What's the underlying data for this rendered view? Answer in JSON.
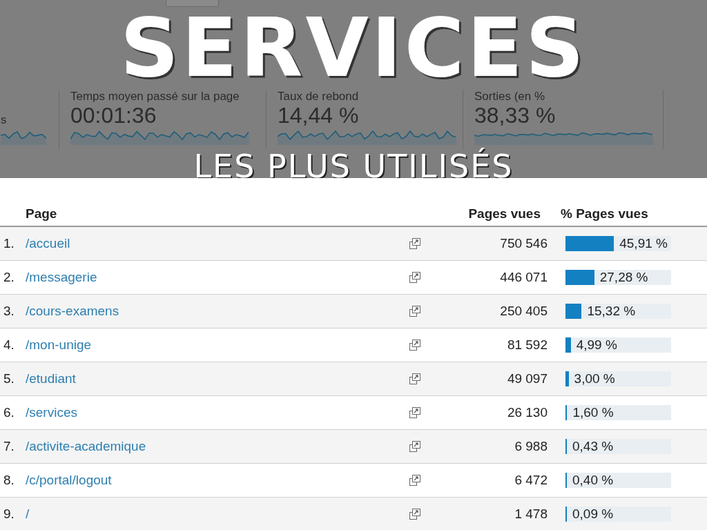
{
  "title": "SERVICES",
  "subtitle": "LES PLUS UTILISÉS",
  "metrics": [
    {
      "label": "s"
    },
    {
      "label": "Temps moyen passé sur la page",
      "value": "00:01:36"
    },
    {
      "label": "Taux de rebond",
      "value": "14,44 %"
    },
    {
      "label": "Sorties (en %",
      "value": "38,33 %"
    }
  ],
  "table": {
    "columns": [
      "Page",
      "Pages vues",
      "% Pages vues"
    ],
    "rows": [
      {
        "rank": "1.",
        "page": "/accueil",
        "views": "750 546",
        "share": "45,91 %",
        "level": 0.4591
      },
      {
        "rank": "2.",
        "page": "/messagerie",
        "views": "446 071",
        "share": "27,28 %",
        "level": 0.2728
      },
      {
        "rank": "3.",
        "page": "/cours-examens",
        "views": "250 405",
        "share": "15,32 %",
        "level": 0.1532
      },
      {
        "rank": "4.",
        "page": "/mon-unige",
        "views": "81 592",
        "share": "4,99 %",
        "level": 0.0499
      },
      {
        "rank": "5.",
        "page": "/etudiant",
        "views": "49 097",
        "share": "3,00 %",
        "level": 0.03
      },
      {
        "rank": "6.",
        "page": "/services",
        "views": "26 130",
        "share": "1,60 %",
        "level": 0.016
      },
      {
        "rank": "7.",
        "page": "/activite-academique",
        "views": "6 988",
        "share": "0,43 %",
        "level": 0.0043
      },
      {
        "rank": "8.",
        "page": "/c/portal/logout",
        "views": "6 472",
        "share": "0,40 %",
        "level": 0.004
      },
      {
        "rank": "9.",
        "page": "/",
        "views": "1 478",
        "share": "0,09 %",
        "level": 0.0009
      }
    ]
  }
}
